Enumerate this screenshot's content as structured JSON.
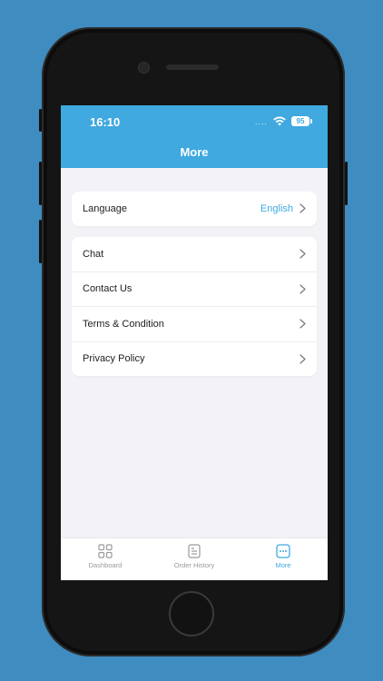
{
  "status_bar": {
    "time": "16:10",
    "signal": "....",
    "battery": "95"
  },
  "header": {
    "title": "More"
  },
  "language_card": {
    "label": "Language",
    "value": "English"
  },
  "menu": [
    {
      "label": "Chat"
    },
    {
      "label": "Contact Us"
    },
    {
      "label": "Terms & Condition"
    },
    {
      "label": "Privacy Policy"
    }
  ],
  "tabs": [
    {
      "label": "Dashboard",
      "icon": "grid-icon",
      "active": false
    },
    {
      "label": "Order History",
      "icon": "document-icon",
      "active": false
    },
    {
      "label": "More",
      "icon": "more-icon",
      "active": true
    }
  ],
  "colors": {
    "accent": "#3fa9e0",
    "background": "#3f8cc1",
    "screen_bg": "#f2f2f7"
  }
}
